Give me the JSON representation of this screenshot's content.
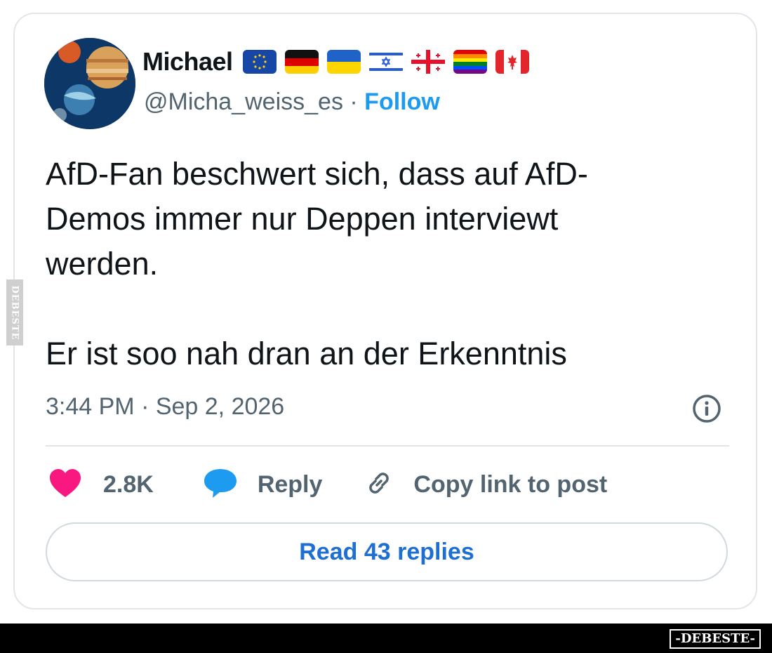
{
  "user": {
    "name": "Michael",
    "handle": "@Micha_weiss_es",
    "separator": " · ",
    "follow_label": "Follow",
    "flags": [
      "eu-flag-icon",
      "germany-flag-icon",
      "ukraine-flag-icon",
      "israel-flag-icon",
      "georgia-flag-icon",
      "rainbow-flag-icon",
      "canada-flag-icon"
    ]
  },
  "tweet": {
    "text": "AfD-Fan beschwert sich, dass auf AfD-\nDemos immer nur Deppen interviewt\nwerden.\n\nEr ist soo nah dran an der Erkenntnis"
  },
  "meta": {
    "timestamp": "3:44 PM · Sep 2, 2026"
  },
  "actions": {
    "likes": "2.8K",
    "reply_label": "Reply",
    "copy_label": "Copy link to post"
  },
  "replies_button": "Read 43 replies",
  "watermark": {
    "footer": "-DEBESTE-",
    "side": "DEBESTE"
  },
  "colors": {
    "like": "#f91880",
    "reply": "#1d9bf0",
    "link": "#1d9bf0",
    "muted": "#536471"
  }
}
